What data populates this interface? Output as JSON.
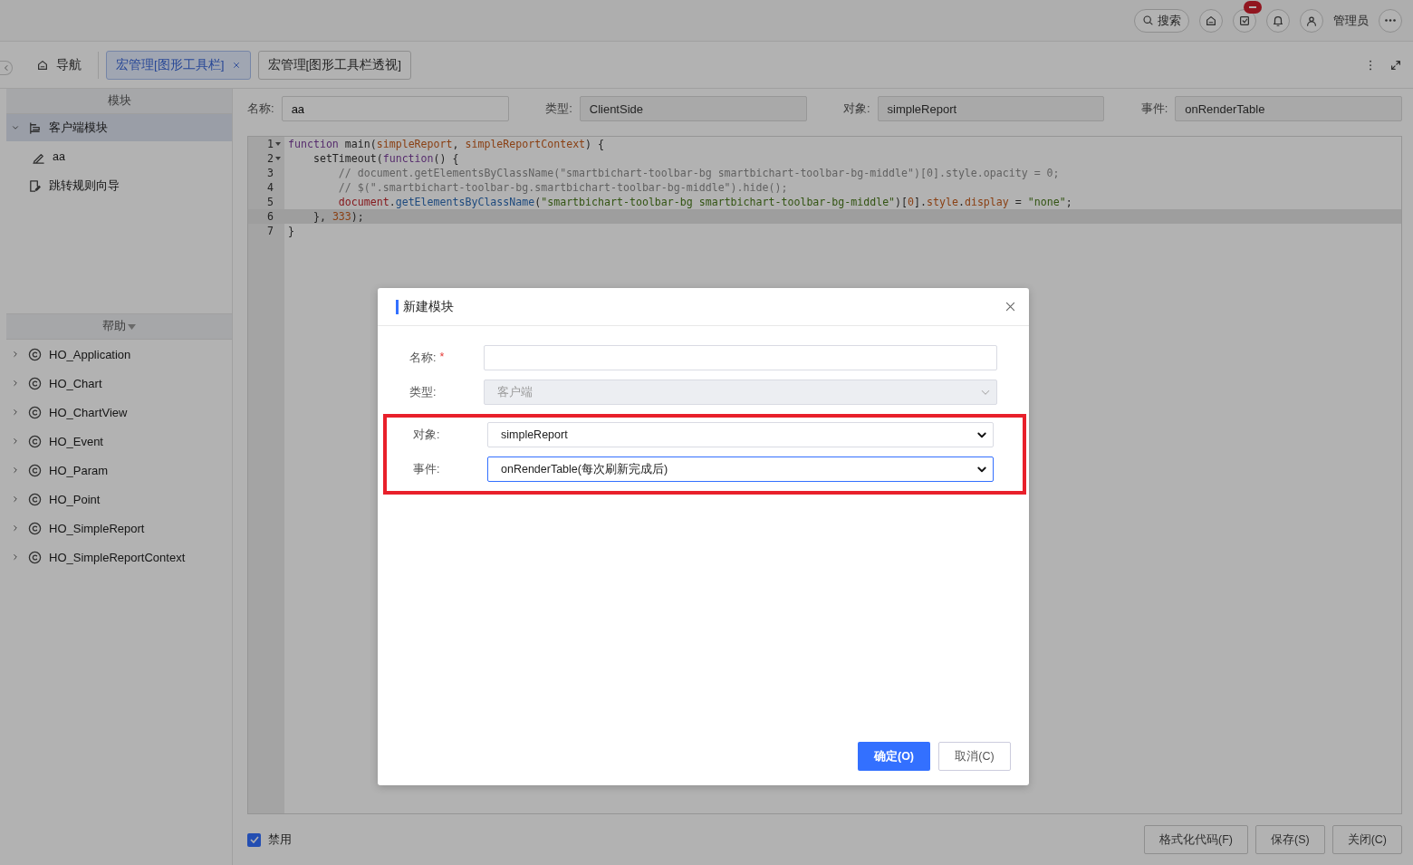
{
  "header": {
    "search_label": "搜索",
    "has_badge": true,
    "user_name": "管理员"
  },
  "tabs": [
    {
      "label": "导航",
      "kind": "home",
      "selected": false
    },
    {
      "label": "宏管理[图形工具栏]",
      "kind": "closable",
      "selected": true
    },
    {
      "label": "宏管理[图形工具栏透视]",
      "kind": "plain",
      "selected": false
    }
  ],
  "sidebar": {
    "modules_title": "模块",
    "modules": [
      {
        "label": "客户端模块",
        "kind": "group",
        "expanded": true,
        "selected": true,
        "children": [
          {
            "label": "aa",
            "kind": "script",
            "selected": false
          }
        ]
      },
      {
        "label": "跳转规则向导",
        "kind": "wizard",
        "selected": false
      }
    ],
    "help_title": "帮助",
    "help_items": [
      {
        "label": "HO_Application",
        "expanded": false
      },
      {
        "label": "HO_Chart",
        "expanded": false
      },
      {
        "label": "HO_ChartView",
        "expanded": false
      },
      {
        "label": "HO_Event",
        "expanded": false
      },
      {
        "label": "HO_Param",
        "expanded": false
      },
      {
        "label": "HO_Point",
        "expanded": false
      },
      {
        "label": "HO_SimpleReport",
        "expanded": false
      },
      {
        "label": "HO_SimpleReportContext",
        "expanded": false
      }
    ]
  },
  "form": [
    {
      "label": "名称:",
      "value": "aa",
      "disabled": false
    },
    {
      "label": "类型:",
      "value": "ClientSide",
      "disabled": true
    },
    {
      "label": "对象:",
      "value": "simpleReport",
      "disabled": true
    },
    {
      "label": "事件:",
      "value": "onRenderTable",
      "disabled": true
    }
  ],
  "editor": {
    "lines": [
      {
        "number": "1",
        "foldable": true,
        "active": false,
        "segments": [
          {
            "kind": "keyword",
            "text": "function"
          },
          {
            "kind": "plain",
            "text": " main("
          },
          {
            "kind": "param",
            "text": "simpleReport"
          },
          {
            "kind": "plain",
            "text": ", "
          },
          {
            "kind": "param",
            "text": "simpleReportContext"
          },
          {
            "kind": "plain",
            "text": ") {"
          }
        ]
      },
      {
        "number": "2",
        "foldable": true,
        "active": false,
        "segments": [
          {
            "kind": "plain",
            "text": "    setTimeout("
          },
          {
            "kind": "keyword",
            "text": "function"
          },
          {
            "kind": "plain",
            "text": "() {"
          }
        ]
      },
      {
        "number": "3",
        "foldable": false,
        "active": false,
        "segments": [
          {
            "kind": "comment",
            "text": "        // document.getElementsByClassName(\"smartbichart-toolbar-bg smartbichart-toolbar-bg-middle\")[0].style.opacity = 0;"
          }
        ]
      },
      {
        "number": "4",
        "foldable": false,
        "active": false,
        "segments": [
          {
            "kind": "comment",
            "text": "        // $(\".smartbichart-toolbar-bg.smartbichart-toolbar-bg-middle\").hide();"
          }
        ]
      },
      {
        "number": "5",
        "foldable": false,
        "active": false,
        "segments": [
          {
            "kind": "builtin",
            "text": "        document"
          },
          {
            "kind": "plain",
            "text": "."
          },
          {
            "kind": "method",
            "text": "getElementsByClassName"
          },
          {
            "kind": "plain",
            "text": "("
          },
          {
            "kind": "string",
            "text": "\"smartbichart-toolbar-bg smartbichart-toolbar-bg-middle\""
          },
          {
            "kind": "plain",
            "text": ")["
          },
          {
            "kind": "number",
            "text": "0"
          },
          {
            "kind": "plain",
            "text": "]."
          },
          {
            "kind": "param",
            "text": "style"
          },
          {
            "kind": "plain",
            "text": "."
          },
          {
            "kind": "param",
            "text": "display"
          },
          {
            "kind": "plain",
            "text": " = "
          },
          {
            "kind": "string",
            "text": "\"none\""
          },
          {
            "kind": "plain",
            "text": ";"
          }
        ]
      },
      {
        "number": "6",
        "foldable": false,
        "active": true,
        "segments": [
          {
            "kind": "plain",
            "text": "    }, "
          },
          {
            "kind": "number",
            "text": "333"
          },
          {
            "kind": "plain",
            "text": ");"
          }
        ]
      },
      {
        "number": "7",
        "foldable": false,
        "active": false,
        "segments": [
          {
            "kind": "plain",
            "text": "}"
          }
        ]
      }
    ]
  },
  "disable_checkbox": {
    "label": "禁用",
    "checked": true
  },
  "footer_buttons": [
    "格式化代码(F)",
    "保存(S)",
    "关闭(C)"
  ],
  "dialog": {
    "title": "新建模块",
    "fields": [
      {
        "label": "名称:",
        "kind": "text",
        "required_mark": "*",
        "disabled": false,
        "focused": false
      },
      {
        "label": "类型:",
        "kind": "select",
        "value": "客户端",
        "disabled": true,
        "focused": false
      }
    ],
    "highlighted_fields": [
      {
        "label": "对象:",
        "kind": "select",
        "value": "simpleReport",
        "disabled": false,
        "focused": false
      },
      {
        "label": "事件:",
        "kind": "select",
        "value": "onRenderTable(每次刷新完成后)",
        "disabled": false,
        "focused": true
      }
    ],
    "ok_button": "确定(O)",
    "cancel_button": "取消(C)"
  }
}
